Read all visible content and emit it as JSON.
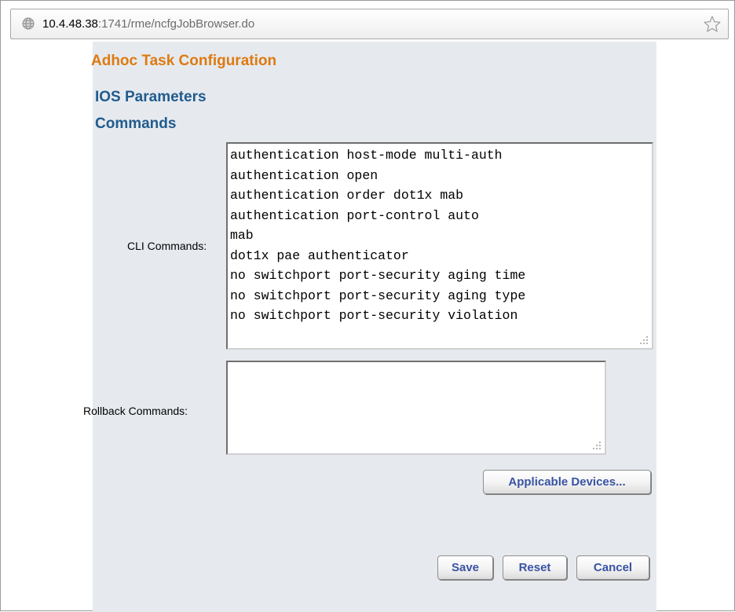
{
  "browser": {
    "url_host": "10.4.48.38",
    "url_rest": ":1741/rme/ncfgJobBrowser.do",
    "page_icon": "globe-icon",
    "bookmark_icon": "star-icon"
  },
  "page": {
    "title": "Adhoc Task Configuration",
    "section_heading": "IOS Parameters",
    "subsection_heading": "Commands"
  },
  "form": {
    "cli_label": "CLI Commands:",
    "cli_value": "authentication host-mode multi-auth\nauthentication open\nauthentication order dot1x mab\nauthentication port-control auto\nmab\ndot1x pae authenticator\nno switchport port-security aging time\nno switchport port-security aging type\nno switchport port-security violation",
    "rollback_label": "Rollback Commands:",
    "rollback_value": ""
  },
  "buttons": {
    "applicable_devices": "Applicable Devices...",
    "save": "Save",
    "reset": "Reset",
    "cancel": "Cancel"
  },
  "colors": {
    "title_orange": "#de7a10",
    "heading_blue": "#215b8d",
    "button_text": "#3853a3",
    "panel_background": "#e6eaef"
  }
}
